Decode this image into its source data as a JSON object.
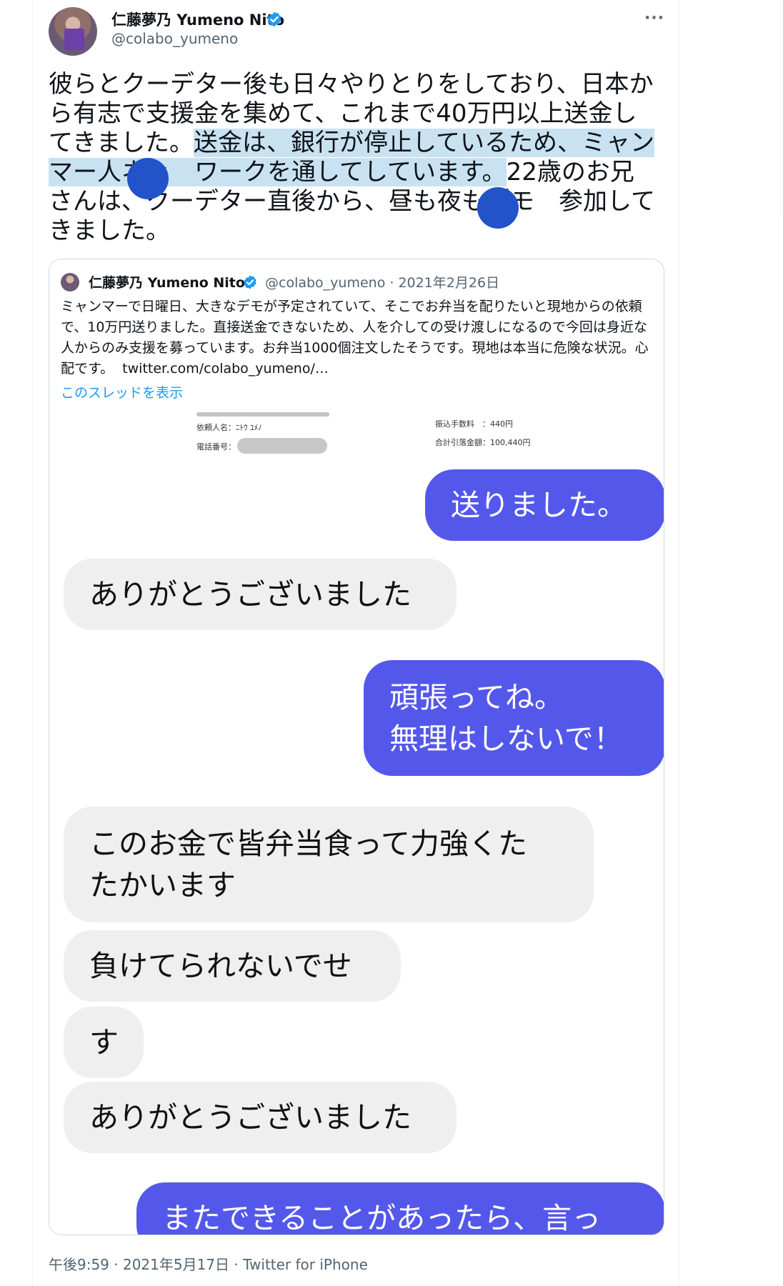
{
  "tweet": {
    "author_name": "仁藤夢乃 Yumeno Nito",
    "handle": "@colabo_yumeno",
    "text_before_highlight": "彼らとクーデター後も日々やりとりをしており、日本から有志で支援金を集めて、これまで40万円以上送金してきました。",
    "text_highlight": "送金は、銀行が停止しているため、ミャンマー人ネッ　ワークを通してしています。",
    "text_after_highlight": "22歳のお兄さんは、クーデター直後から、昼も夜もデモ　参加してきました。",
    "timestamp": "午後9:59 · 2021年5月17日 · Twitter for iPhone",
    "highlight_color": "#c9e2f2",
    "redaction_color": "#2253c9"
  },
  "quote": {
    "author_name": "仁藤夢乃 Yumeno Nito",
    "handle_and_date": "@colabo_yumeno · 2021年2月26日",
    "text": "ミャンマーで日曜日、大きなデモが予定されていて、そこでお弁当を配りたいと現地からの依頼で、10万円送りました。直接送金できないため、人を介しての受け渡しになるので今回は身近な人からのみ支援を募っています。お弁当1000個注文したそうです。現地は本当に危険な状況。心配です。  twitter.com/colabo_yumeno/…",
    "show_thread_label": "このスレッドを表示"
  },
  "receipt": {
    "requester_label": "依頼人名：ﾆﾄｳ ﾕﾒﾉ",
    "phone_label": "電話番号：",
    "fee_label": "振込手数料　：440円",
    "total_label": "合計引落金額：100,440円"
  },
  "chat": {
    "messages": [
      {
        "side": "out",
        "text": "送りました。"
      },
      {
        "side": "in",
        "text": "ありがとうございました"
      },
      {
        "side": "out",
        "text": "頑張ってね。\n無理はしないで！"
      },
      {
        "side": "in",
        "text": "このお金で皆弁当食って力強くた\nたかいます"
      },
      {
        "side": "in",
        "text": "負けてられないでせ"
      },
      {
        "side": "in",
        "text": "す"
      },
      {
        "side": "in",
        "text": "ありがとうございました"
      },
      {
        "side": "out",
        "text": "またできることがあったら、言っ"
      }
    ],
    "outgoing_color": "#5458ea",
    "incoming_color": "#efefef"
  },
  "icons": {
    "verified": "verified-badge-icon",
    "more": "more-horizontal-icon"
  }
}
